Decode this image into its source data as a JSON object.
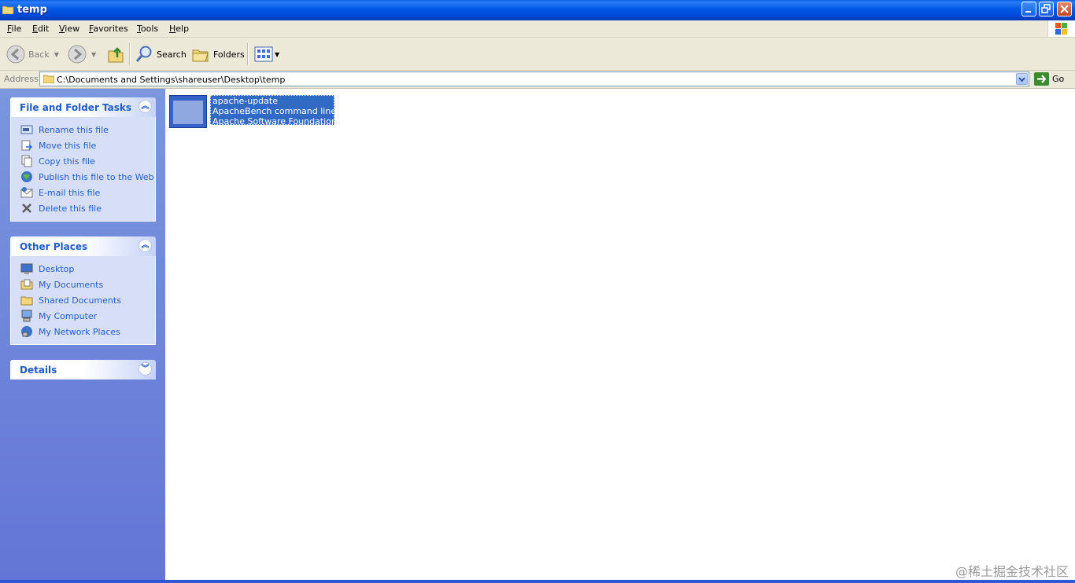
{
  "window": {
    "title": "temp"
  },
  "menu": {
    "items": [
      {
        "label": "File",
        "underline": "F",
        "rest": "ile"
      },
      {
        "label": "Edit",
        "underline": "E",
        "rest": "dit"
      },
      {
        "label": "View",
        "underline": "V",
        "rest": "iew"
      },
      {
        "label": "Favorites",
        "underline": "F",
        "rest": "avorites"
      },
      {
        "label": "Tools",
        "underline": "T",
        "rest": "ools"
      },
      {
        "label": "Help",
        "underline": "H",
        "rest": "elp"
      }
    ]
  },
  "toolbar": {
    "back_label": "Back",
    "search_label": "Search",
    "folders_label": "Folders"
  },
  "address": {
    "label": "Address",
    "path": "C:\\Documents and Settings\\shareuser\\Desktop\\temp",
    "go_label": "Go"
  },
  "sidebar": {
    "file_tasks": {
      "title": "File and Folder Tasks",
      "items": [
        {
          "label": "Rename this file",
          "icon": "rename-icon"
        },
        {
          "label": "Move this file",
          "icon": "move-icon"
        },
        {
          "label": "Copy this file",
          "icon": "copy-icon"
        },
        {
          "label": "Publish this file to the Web",
          "icon": "globe-icon"
        },
        {
          "label": "E-mail this file",
          "icon": "email-icon"
        },
        {
          "label": "Delete this file",
          "icon": "delete-icon"
        }
      ]
    },
    "other_places": {
      "title": "Other Places",
      "items": [
        {
          "label": "Desktop",
          "icon": "desktop-icon"
        },
        {
          "label": "My Documents",
          "icon": "my-documents-icon"
        },
        {
          "label": "Shared Documents",
          "icon": "shared-folder-icon"
        },
        {
          "label": "My Computer",
          "icon": "my-computer-icon"
        },
        {
          "label": "My Network Places",
          "icon": "network-places-icon"
        }
      ]
    },
    "details": {
      "title": "Details"
    }
  },
  "files": [
    {
      "name": "apache-update",
      "description": "ApacheBench command line ut...",
      "company": "Apache Software Foundation"
    }
  ],
  "watermark": "@稀土掘金技术社区",
  "colors": {
    "title_blue": "#0058e6",
    "task_link": "#215dc6",
    "panel_bg": "#6f85da",
    "selection": "#316ac5"
  }
}
